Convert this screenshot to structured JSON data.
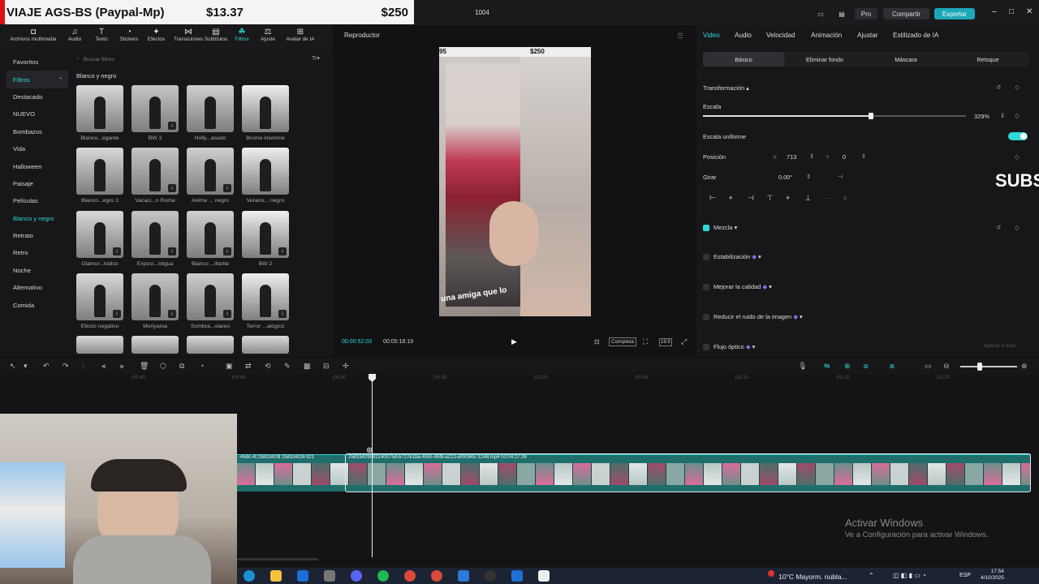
{
  "banner": {
    "title": "VIAJE AGS-BS (Paypal-Mp)",
    "price1": "$13.37",
    "price2": "$250"
  },
  "window": {
    "project": "1004",
    "pro": "Pro",
    "share": "Compartir",
    "export": "Exportar"
  },
  "toolbar": [
    {
      "label": "Archivos multimedia",
      "icon": "media-icon"
    },
    {
      "label": "Audio",
      "icon": "audio-icon"
    },
    {
      "label": "Texto",
      "icon": "text-icon"
    },
    {
      "label": "Stickers",
      "icon": "sticker-icon"
    },
    {
      "label": "Efectos",
      "icon": "effects-icon"
    },
    {
      "label": "Transiciones",
      "icon": "transitions-icon"
    },
    {
      "label": "Subtítulos",
      "icon": "subtitles-icon"
    },
    {
      "label": "Filtros",
      "icon": "filter-icon"
    },
    {
      "label": "Ajuste",
      "icon": "adjust-icon"
    },
    {
      "label": "Avatar de IA",
      "icon": "avatar-icon"
    }
  ],
  "categories": [
    "Favoritos",
    "Filtros",
    "Destacado",
    "NUEVO",
    "Bombazos",
    "Vida",
    "Halloween",
    "Paisaje",
    "Películas",
    "Blanco y negro",
    "Retrato",
    "Retro",
    "Noche",
    "Alternativo",
    "Comida"
  ],
  "search_placeholder": "Buscar filtros",
  "group_title": "Blanco y negro",
  "filters": [
    "Blanco...egante",
    "BW 3",
    "Holly...asado",
    "Bruma insomne",
    "Blanco...egro 1",
    "Vacaci...n Roma",
    "Anime ... negro",
    "Verano... negro",
    "Glamur...lódico",
    "Exposi...ntigua",
    "Blanco ...illante",
    "BW 2",
    "Efecto negativo",
    "Moriyama",
    "Sombra...olares",
    "Terror ...alógico"
  ],
  "player": {
    "title": "Reproductor",
    "current": "00:00:52:03",
    "total": "00:05:18:19",
    "ratio": "Completa",
    "video_price": "$250",
    "video_left": "95",
    "caption": "una amiga que lo"
  },
  "right": {
    "tabs": [
      "Video",
      "Audio",
      "Velocidad",
      "Animación",
      "Ajustar",
      "Estilizado de IA"
    ],
    "subtabs": [
      "Básico",
      "Eliminar fondo",
      "Máscara",
      "Retoque"
    ],
    "transform": "Transformación",
    "scale_label": "Escala",
    "scale_value": "329%",
    "scale_fraction": 0.64,
    "uniform": "Escala uniforme",
    "pos_label": "Posición",
    "pos_x_label": "X",
    "pos_x": "713",
    "pos_y_label": "Y",
    "pos_y": "0",
    "rotate_label": "Girar",
    "rotate": "0.00°",
    "blend": "Mezcla",
    "stab": "Estabilización",
    "quality": "Mejorar la calidad",
    "noise": "Reducir el ruido de la imagen",
    "flow": "Flujo óptico",
    "apply_all": "Aplicar a todo",
    "overlay": "SUBS"
  },
  "timeline": {
    "ruler": [
      "|00:40",
      "|00:45",
      "|00:50",
      "|00:55",
      "|01:00",
      "|01:05",
      "|01:10",
      "|01:15",
      "|01:20"
    ],
    "clip0": "-459c-4l  25833429l  25833429l-921",
    "clip": "25833429l-921400758-b727e1ba-459c-45f8-a213-ef0094571248.mp4   00:04:27:26"
  },
  "activate": {
    "line1": "Activar Windows",
    "line2": "Ve a Configuración para activar Windows."
  },
  "taskbar": {
    "weather": "10°C  Mayorm. nubla...",
    "lang": "ESP",
    "time": "17:54",
    "date": "4/10/2025"
  }
}
